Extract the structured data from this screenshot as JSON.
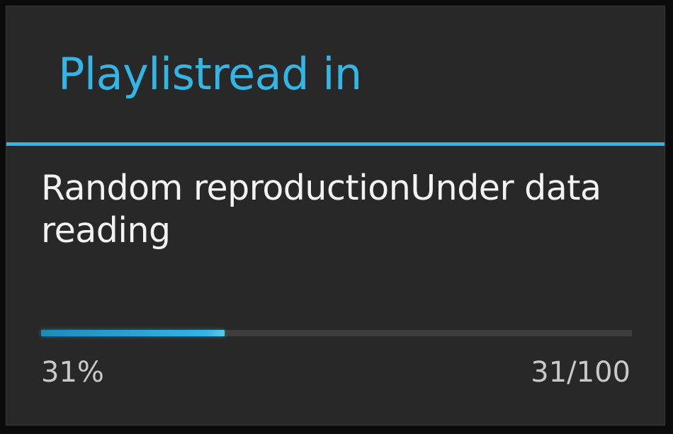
{
  "dialog": {
    "title": "Playlistread in",
    "message": "Random reproductionUnder data reading",
    "progress": {
      "fraction": 0.31,
      "percent_label": "31%",
      "count_label": "31/100"
    }
  },
  "colors": {
    "accent": "#33b5e5",
    "dialog_background": "#282828",
    "message_text": "#f2f2f2",
    "secondary_text": "#c8c8c8",
    "track": "#3d3d3d"
  }
}
